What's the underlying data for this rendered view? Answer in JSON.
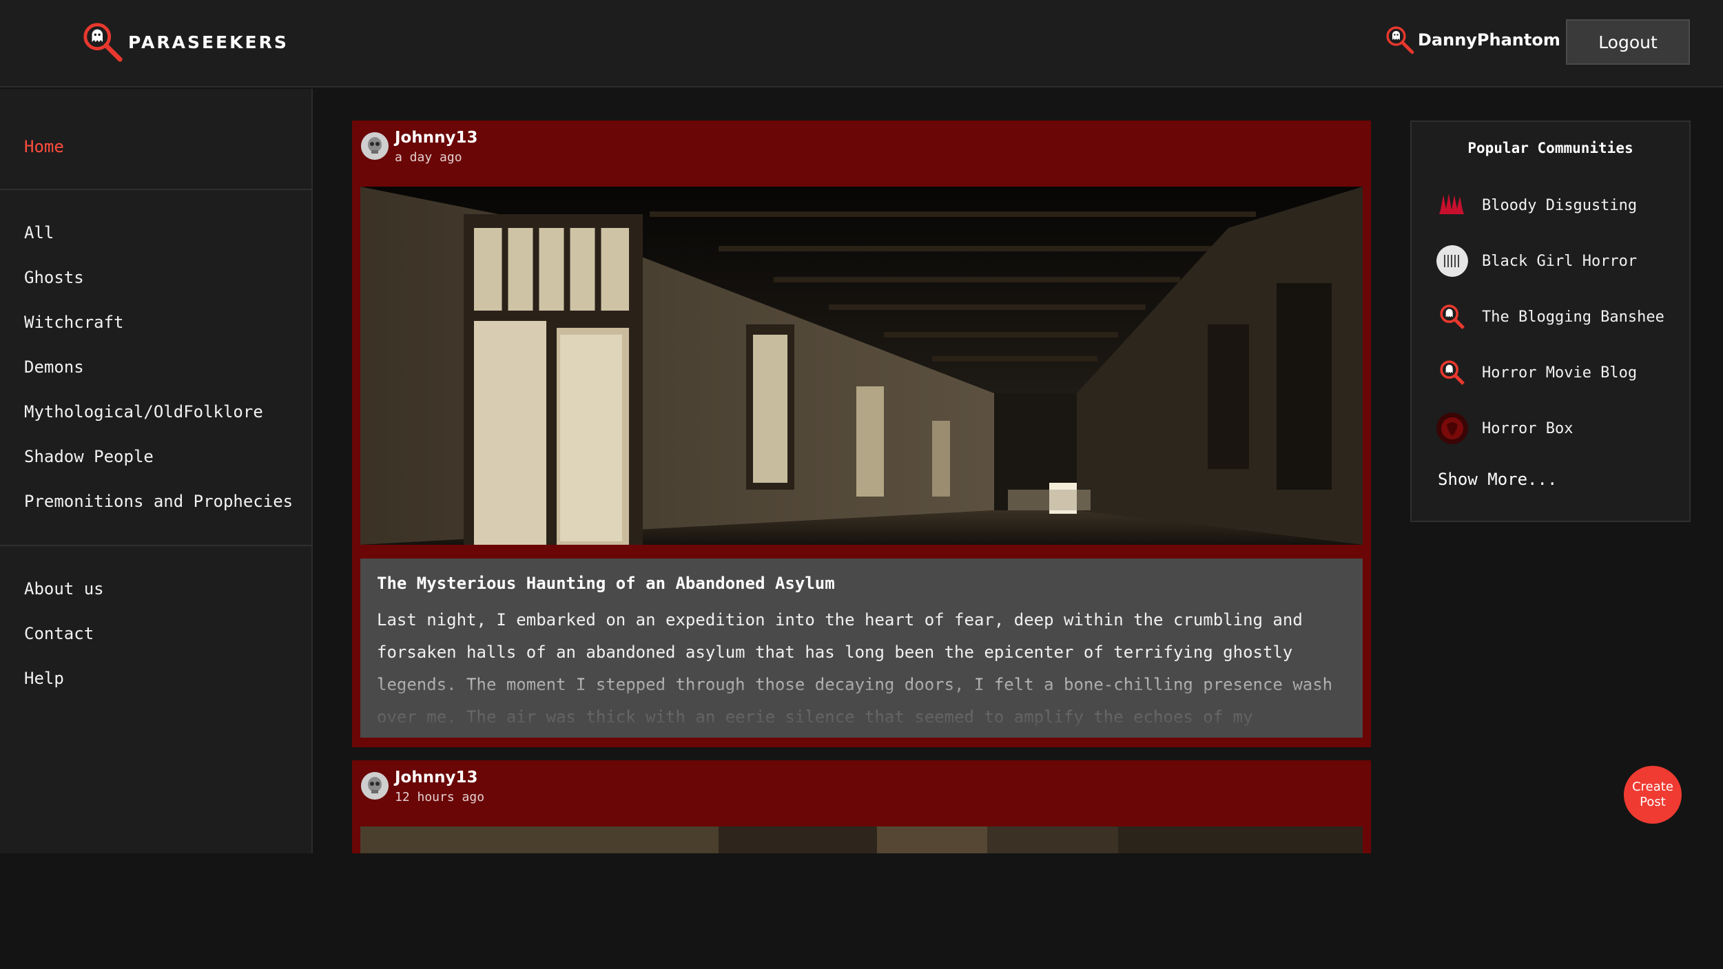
{
  "header": {
    "brand": "PARASEEKERS",
    "username": "DannyPhantom",
    "logout_label": "Logout"
  },
  "sidebar": {
    "home": "Home",
    "categories": [
      "All",
      "Ghosts",
      "Witchcraft",
      "Demons",
      "Mythological/OldFolklore",
      "Shadow People",
      "Premonitions and Prophecies"
    ],
    "info": [
      "About us",
      "Contact",
      "Help"
    ]
  },
  "posts": [
    {
      "author": "Johnny13",
      "time": "a day ago",
      "title": "The Mysterious Haunting of an Abandoned Asylum",
      "body": "Last night, I embarked on an expedition into the heart of fear, deep within the crumbling and forsaken halls of an abandoned asylum that has long been the epicenter of terrifying ghostly legends. The moment I stepped through those decaying doors, I felt a bone-chilling presence wash over me. The air was thick with an eerie silence that seemed to amplify the echoes of my footsteps"
    },
    {
      "author": "Johnny13",
      "time": "12 hours ago"
    }
  ],
  "communities": {
    "title": "Popular Communities",
    "items": [
      {
        "name": "Bloody Disgusting",
        "icon": "bloody-disgusting-logo"
      },
      {
        "name": "Black Girl Horror",
        "icon": "black-girl-horror-logo"
      },
      {
        "name": "The Blogging Banshee",
        "icon": "paraseekers-logo"
      },
      {
        "name": "Horror Movie Blog",
        "icon": "paraseekers-logo"
      },
      {
        "name": "Horror Box",
        "icon": "horror-box-logo"
      }
    ],
    "show_more": "Show More..."
  },
  "create_post_label": "Create Post",
  "colors": {
    "accent": "#ef3b32",
    "post_frame": "#6a0606",
    "background": "#141414",
    "panel": "#1d1d1d"
  }
}
